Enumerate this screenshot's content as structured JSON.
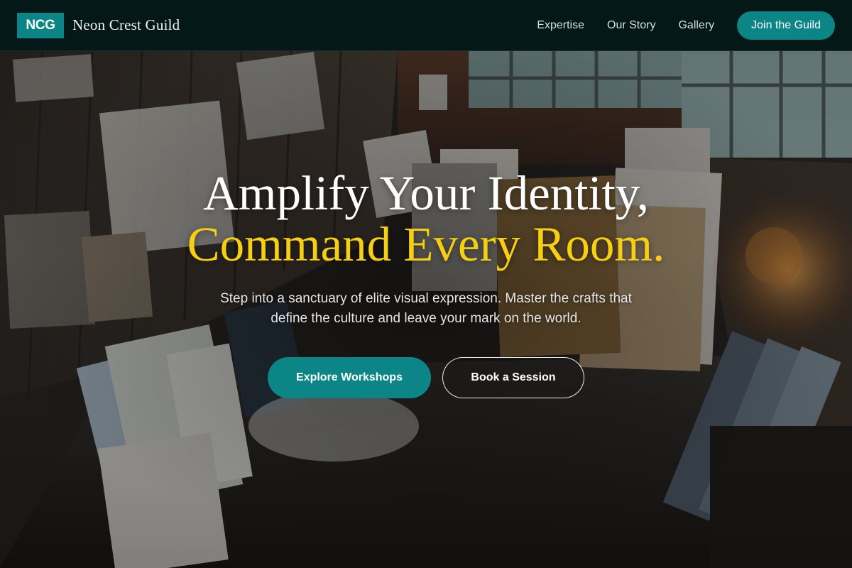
{
  "header": {
    "logo_badge": "NCG",
    "brand_name": "Neon Crest Guild",
    "nav": [
      {
        "label": "Expertise"
      },
      {
        "label": "Our Story"
      },
      {
        "label": "Gallery"
      }
    ],
    "cta_label": "Join the Guild"
  },
  "hero": {
    "title_line1": "Amplify Your Identity,",
    "title_line2": "Command Every Room.",
    "subtitle_line1": "Step into a sanctuary of elite visual expression. Master the crafts that",
    "subtitle_line2": "define the culture and leave your mark on the world.",
    "primary_button": "Explore Workshops",
    "secondary_button": "Book a Session",
    "background_image": "art-studio-photo"
  },
  "colors": {
    "accent_teal": "#0b8585",
    "accent_gold": "#f7cf12",
    "header_bg": "#021818"
  }
}
